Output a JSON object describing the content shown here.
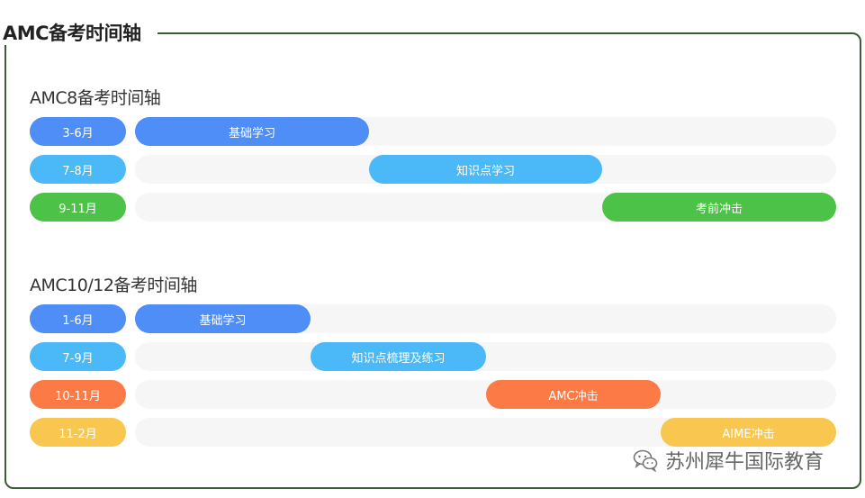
{
  "main_title": "AMC备考时间轴",
  "amc8": {
    "title": "AMC8备考时间轴",
    "rows": [
      {
        "period": "3-6月",
        "task": "基础学习",
        "color": "#4f8ef7",
        "start": 0,
        "span": 1
      },
      {
        "period": "7-8月",
        "task": "知识点学习",
        "color": "#4bb8f8",
        "start": 1,
        "span": 1
      },
      {
        "period": "9-11月",
        "task": "考前冲击",
        "color": "#4dc249",
        "start": 2,
        "span": 1
      }
    ],
    "segments": 3
  },
  "amc1012": {
    "title": "AMC10/12备考时间轴",
    "rows": [
      {
        "period": "1-6月",
        "task": "基础学习",
        "color": "#4f8ef7",
        "start": 0,
        "span": 1
      },
      {
        "period": "7-9月",
        "task": "知识点梳理及练习",
        "color": "#4bb8f8",
        "start": 1,
        "span": 1
      },
      {
        "period": "10-11月",
        "task": "AMC冲击",
        "color": "#fb7a46",
        "start": 2,
        "span": 1
      },
      {
        "period": "11-2月",
        "task": "AIME冲击",
        "color": "#f9c750",
        "start": 3,
        "span": 1
      }
    ],
    "segments": 4
  },
  "watermark": {
    "text": "苏州犀牛国际教育",
    "icon": "wechat-icon"
  }
}
